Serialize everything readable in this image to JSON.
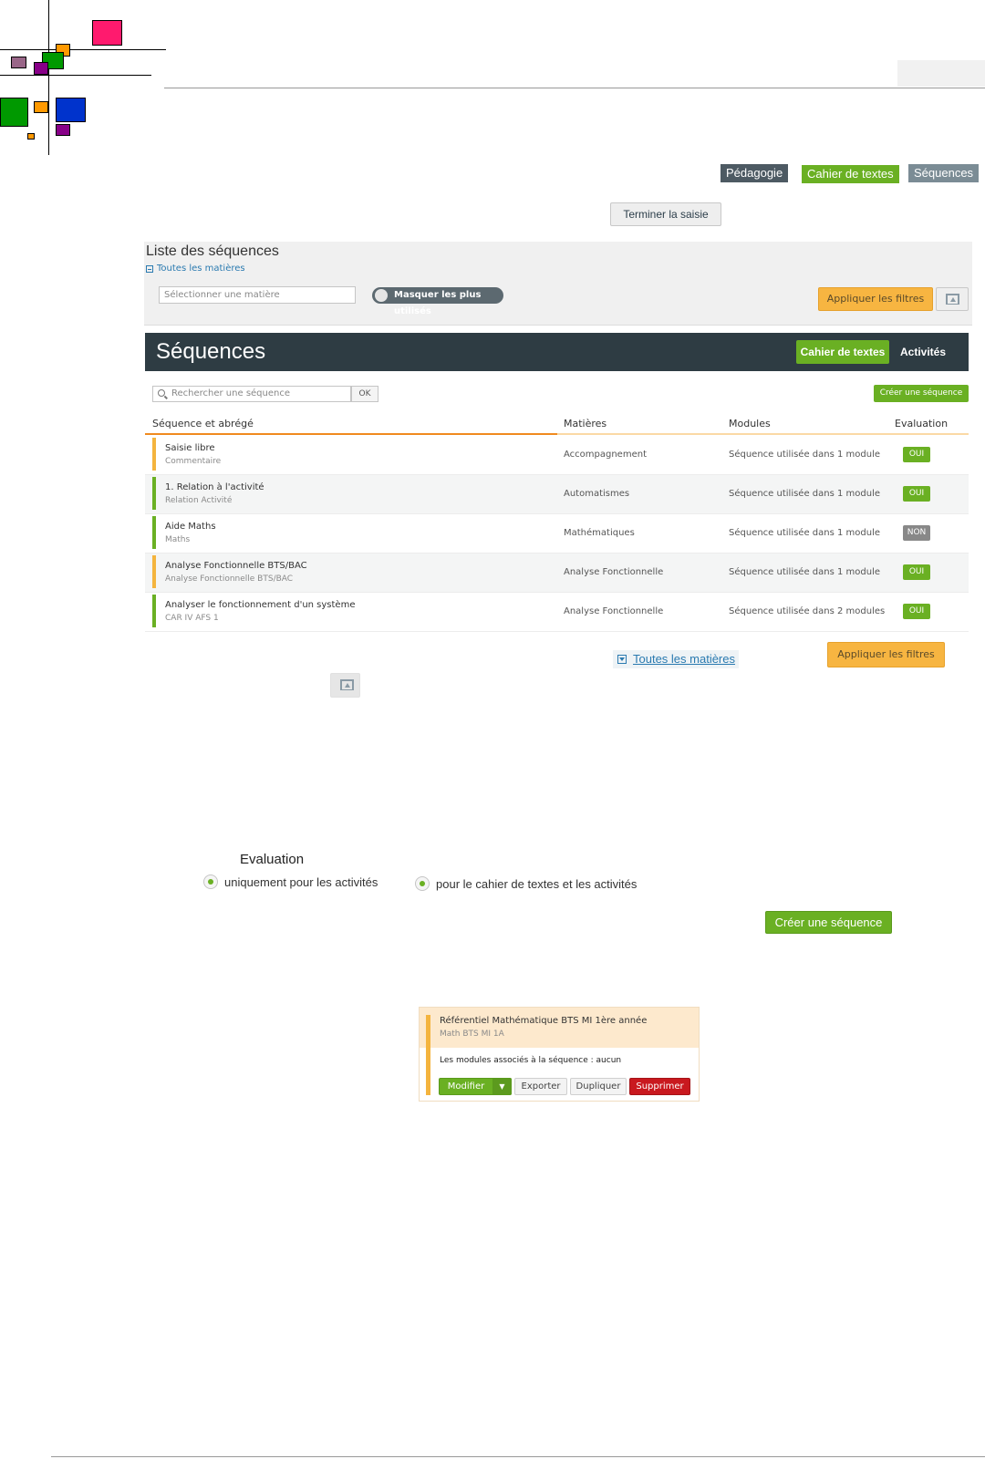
{
  "breadcrumb": {
    "items": [
      "Pédagogie",
      "Cahier de textes",
      "Séquences"
    ]
  },
  "actions": {
    "terminer_label": "Terminer la saisie"
  },
  "filters": {
    "title": "Liste des séquences",
    "toggle_label": "Toutes les matières",
    "select_placeholder": "Sélectionner une matière",
    "masquer_label": "Masquer les plus utilisés",
    "apply_label": "Appliquer les filtres"
  },
  "panel": {
    "title": "Séquences",
    "tabs": [
      "Cahier de textes",
      "Activités"
    ],
    "search_placeholder": "Rechercher une séquence",
    "ok_label": "OK",
    "create_label": "Créer une séquence"
  },
  "table": {
    "headers": [
      "Séquence et abrégé",
      "Matières",
      "Modules",
      "Evaluation"
    ],
    "rows": [
      {
        "name": "Saisie libre",
        "abbr": "Commentaire",
        "matiere": "Accompagnement",
        "modules": "Séquence utilisée dans 1 module",
        "eval": "OUI",
        "color": "#f4b43e"
      },
      {
        "name": "1. Relation à l'activité",
        "abbr": "Relation Activité",
        "matiere": "Automatismes",
        "modules": "Séquence utilisée dans 1 module",
        "eval": "OUI",
        "color": "#6ab023"
      },
      {
        "name": "Aide Maths",
        "abbr": "Maths",
        "matiere": "Mathématiques",
        "modules": "Séquence utilisée dans 1 module",
        "eval": "NON",
        "color": "#6ab023"
      },
      {
        "name": "Analyse Fonctionnelle BTS/BAC",
        "abbr": "Analyse Fonctionnelle BTS/BAC",
        "matiere": "Analyse Fonctionnelle",
        "modules": "Séquence utilisée dans 1 module",
        "eval": "OUI",
        "color": "#f4b43e"
      },
      {
        "name": "Analyser le fonctionnement d'un système",
        "abbr": "CAR IV AFS 1",
        "matiere": "Analyse Fonctionnelle",
        "modules": "Séquence utilisée dans 2 modules",
        "eval": "OUI",
        "color": "#6ab023"
      }
    ]
  },
  "lower": {
    "toggle_label": "Toutes les matières",
    "apply_label": "Appliquer les filtres"
  },
  "evaluation": {
    "title": "Evaluation",
    "option1": "uniquement pour les activités",
    "option2": "pour le cahier de textes et les activités",
    "create_label": "Créer une séquence"
  },
  "card": {
    "name": "Référentiel Mathématique BTS MI 1ère année",
    "abbr": "Math BTS MI 1A",
    "modules": "Les modules associés à la séquence : aucun",
    "buttons": {
      "modifier": "Modifier",
      "caret": "▼",
      "exporter": "Exporter",
      "dupliquer": "Dupliquer",
      "supprimer": "Supprimer"
    }
  },
  "colors": {
    "green": "#6ab023",
    "orange": "#f4b43e",
    "dark_header": "#2e3c43",
    "red": "#c9191f",
    "badge_no": "#888888"
  }
}
